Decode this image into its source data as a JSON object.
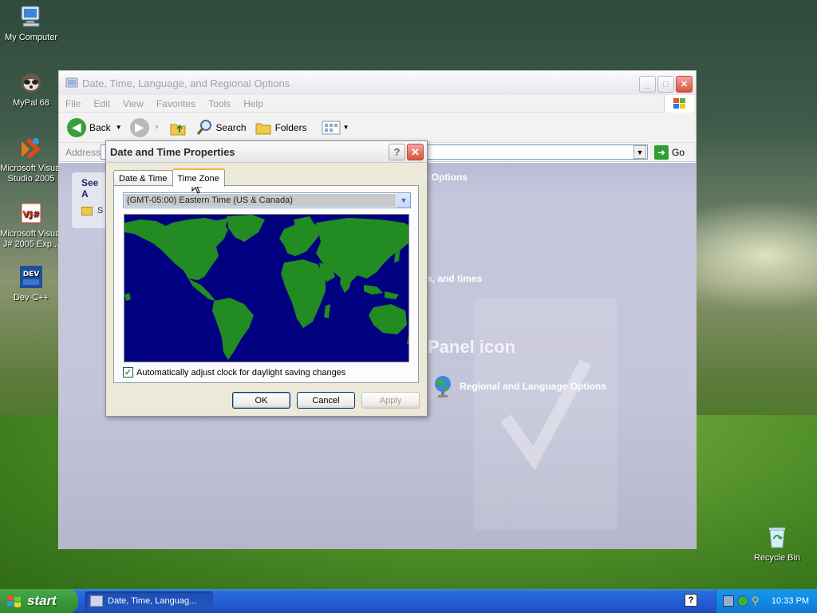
{
  "desktop": {
    "icons": [
      {
        "label": "My Computer"
      },
      {
        "label": "MyPal 68"
      },
      {
        "label": "Microsoft Visual Studio 2005"
      },
      {
        "label": "Microsoft Visual J# 2005 Exp..."
      },
      {
        "label": "Dev-C++"
      },
      {
        "label": "Recycle Bin"
      }
    ]
  },
  "explorer": {
    "title": "Date, Time, Language, and Regional Options",
    "menu": [
      "File",
      "Edit",
      "View",
      "Favorites",
      "Tools",
      "Help"
    ],
    "toolbar": {
      "back": "Back",
      "search": "Search",
      "folders": "Folders"
    },
    "address_label": "Address",
    "go_label": "Go",
    "see_also": "See A",
    "see_also_item": "S",
    "heading_fragment": "l Options",
    "task_fragment": "s, and times",
    "panel_icon_fragment": "Panel icon",
    "regional_link": "Regional and Language Options"
  },
  "dialog": {
    "title": "Date and Time Properties",
    "tabs": [
      "Date & Time",
      "Time Zone"
    ],
    "active_tab": "Time Zone",
    "timezone": "(GMT-05:00) Eastern Time (US & Canada)",
    "dst_checkbox_label": "Automatically adjust clock for daylight saving changes",
    "dst_checked": true,
    "buttons": {
      "ok": "OK",
      "cancel": "Cancel",
      "apply": "Apply"
    },
    "map_colors": {
      "ocean": "#000080",
      "land": "#228b22"
    }
  },
  "taskbar": {
    "start": "start",
    "task": "Date, Time, Languag...",
    "clock": "10:33 PM"
  }
}
